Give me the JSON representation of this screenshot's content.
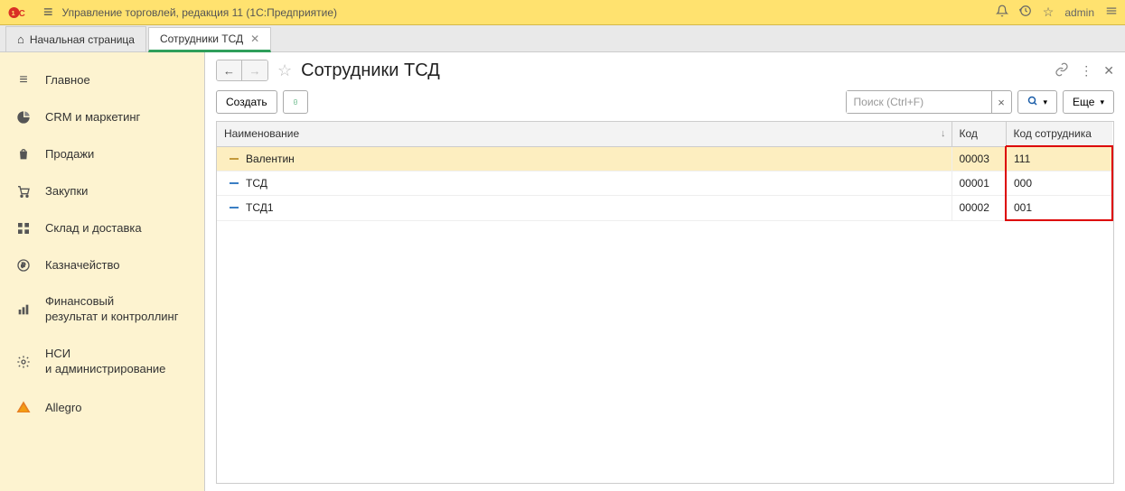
{
  "title": "Управление торговлей, редакция 11  (1С:Предприятие)",
  "user": "admin",
  "tabs": {
    "home": "Начальная страница",
    "active": "Сотрудники ТСД"
  },
  "sidebar": {
    "items": [
      {
        "label": "Главное"
      },
      {
        "label": "CRM и маркетинг"
      },
      {
        "label": "Продажи"
      },
      {
        "label": "Закупки"
      },
      {
        "label": "Склад и доставка"
      },
      {
        "label": "Казначейство"
      },
      {
        "label": "Финансовый\nрезультат и контроллинг"
      },
      {
        "label": "НСИ\nи администрирование"
      },
      {
        "label": "Allegro"
      }
    ]
  },
  "page": {
    "title": "Сотрудники ТСД"
  },
  "toolbar": {
    "create": "Создать",
    "search_placeholder": "Поиск (Ctrl+F)",
    "more": "Еще"
  },
  "table": {
    "headers": {
      "name": "Наименование",
      "code": "Код",
      "emp_code": "Код сотрудника"
    },
    "rows": [
      {
        "name": "Валентин",
        "code": "00003",
        "emp_code": "111",
        "selected": true
      },
      {
        "name": "ТСД",
        "code": "00001",
        "emp_code": "000",
        "selected": false
      },
      {
        "name": "ТСД1",
        "code": "00002",
        "emp_code": "001",
        "selected": false
      }
    ]
  }
}
